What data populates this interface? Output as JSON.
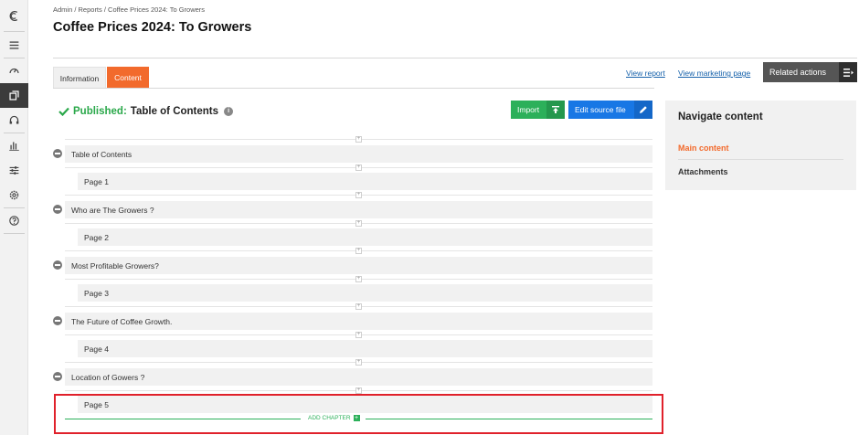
{
  "breadcrumb": "Admin / Reports / Coffee Prices 2024: To Growers",
  "page_title": "Coffee Prices 2024: To Growers",
  "tabs": [
    {
      "label": "Information",
      "active": false
    },
    {
      "label": "Content",
      "active": true
    }
  ],
  "links": {
    "view_report": "View report",
    "view_marketing": "View marketing page"
  },
  "related_actions": "Related actions",
  "status": {
    "published_label": "Published:",
    "item_name": "Table of Contents",
    "info_icon": "i"
  },
  "buttons": {
    "import": "Import",
    "edit_source": "Edit source file"
  },
  "tree": [
    {
      "type": "chapter",
      "label": "Table of Contents"
    },
    {
      "type": "page",
      "label": "Page 1"
    },
    {
      "type": "chapter",
      "label": "Who are The Growers ?"
    },
    {
      "type": "page",
      "label": "Page 2"
    },
    {
      "type": "chapter",
      "label": "Most Profitable Growers?"
    },
    {
      "type": "page",
      "label": "Page 3"
    },
    {
      "type": "chapter",
      "label": "The Future of Coffee Growth."
    },
    {
      "type": "page",
      "label": "Page 4"
    },
    {
      "type": "chapter",
      "label": "Location of Gowers ?"
    },
    {
      "type": "page",
      "label": "Page 5"
    }
  ],
  "add_chapter": "ADD CHAPTER",
  "navigate": {
    "title": "Navigate content",
    "items": [
      {
        "label": "Main content",
        "active": true
      },
      {
        "label": "Attachments",
        "active": false
      }
    ]
  },
  "colors": {
    "accent": "#f26a2c",
    "published": "#2aa84a",
    "import": "#2cb05a",
    "edit": "#1877e5",
    "highlight": "#e0212b",
    "link": "#1460aa"
  },
  "rail_icons": [
    "logo-icon",
    "menu-icon",
    "dashboard-icon",
    "content-icon",
    "headset-icon",
    "reports-icon",
    "filters-icon",
    "settings-icon",
    "help-icon"
  ]
}
